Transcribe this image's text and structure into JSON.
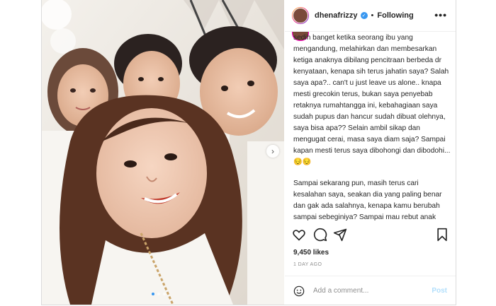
{
  "header": {
    "username": "dhenafrizzy",
    "verified_icon": "verified-badge-icon",
    "separator": "•",
    "follow_status": "Following",
    "more_icon": "more-options-icon"
  },
  "caption": {
    "text": "sedih banget ketika seorang ibu yang mengandung, melahirkan dan membesarkan ketiga anaknya dibilang pencitraan berbeda dr kenyataan, kenapa sih terus jahatin saya? Salah saya apa?.. can't u just leave us alone.. knapa mesti grecokin terus, bukan saya penyebab retaknya rumahtangga ini, kebahagiaan saya sudah pupus dan hancur sudah dibuat olehnya, saya bisa apa?? Selain ambil sikap dan mengugat cerai, masa saya diam saja? Sampai kapan mesti terus saya dibohongi dan dibodohi... 😔😔",
    "text2": "Sampai sekarang pun, masih terus cari kesalahan saya, seakan dia yang paling benar dan gak ada salahnya, kenapa kamu berubah sampai sebeginiya? Sampai mau rebut anak anak dr pelukanku, what we have is real!"
  },
  "actions": {
    "like_icon": "heart-icon",
    "comment_icon": "comment-icon",
    "share_icon": "share-icon",
    "save_icon": "bookmark-icon"
  },
  "likes": "9,450 likes",
  "date": "1 DAY AGO",
  "comment": {
    "emoji_icon": "emoji-icon",
    "placeholder": "Add a comment...",
    "post_label": "Post"
  },
  "photo": {
    "next_icon": "chevron-right-icon",
    "slide_count": 3,
    "active_slide": 1
  },
  "colors": {
    "accent": "#3897f0",
    "post_disabled": "#b2dffc",
    "border": "#dbdbdb"
  }
}
